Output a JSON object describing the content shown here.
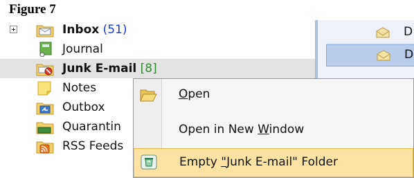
{
  "figure": {
    "title": "Figure 7"
  },
  "folders": [
    {
      "name": "Inbox",
      "count": "(51)",
      "bold": true,
      "icon": "inbox-folder-icon",
      "expander": true
    },
    {
      "name": "Journal",
      "count": "",
      "bold": false,
      "icon": "journal-icon"
    },
    {
      "name": "Junk E-mail",
      "count": "[8]",
      "bold": true,
      "icon": "junk-email-folder-icon",
      "selected": true
    },
    {
      "name": "Notes",
      "count": "",
      "bold": false,
      "icon": "notes-icon"
    },
    {
      "name": "Outbox",
      "count": "",
      "bold": false,
      "icon": "outbox-folder-icon"
    },
    {
      "name": "Quarantin",
      "count": "",
      "bold": false,
      "icon": "quarantine-folder-icon"
    },
    {
      "name": "RSS Feeds",
      "count": "",
      "bold": false,
      "icon": "rss-feeds-icon"
    }
  ],
  "mail_list": [
    {
      "text": "D",
      "icon": "envelope-icon"
    },
    {
      "text": "D",
      "icon": "envelope-icon",
      "highlighted": true
    }
  ],
  "context_menu": {
    "items": [
      {
        "label_before": "",
        "mnemonic": "O",
        "label_after": "pen",
        "icon": "open-folder-icon"
      },
      {
        "label_before": "Open in New ",
        "mnemonic": "W",
        "label_after": "indow",
        "icon": ""
      },
      {
        "label_before": "Empty ",
        "mnemonic": "\"",
        "label_after": "Junk E-mail\" Folder",
        "icon": "empty-recycle-icon",
        "highlighted": true
      }
    ]
  },
  "colors": {
    "unread_count": "#1b3bd8",
    "junk_count": "#2e8b2e",
    "menu_highlight": "#fde3a3",
    "selection": "#b9cdeb"
  }
}
